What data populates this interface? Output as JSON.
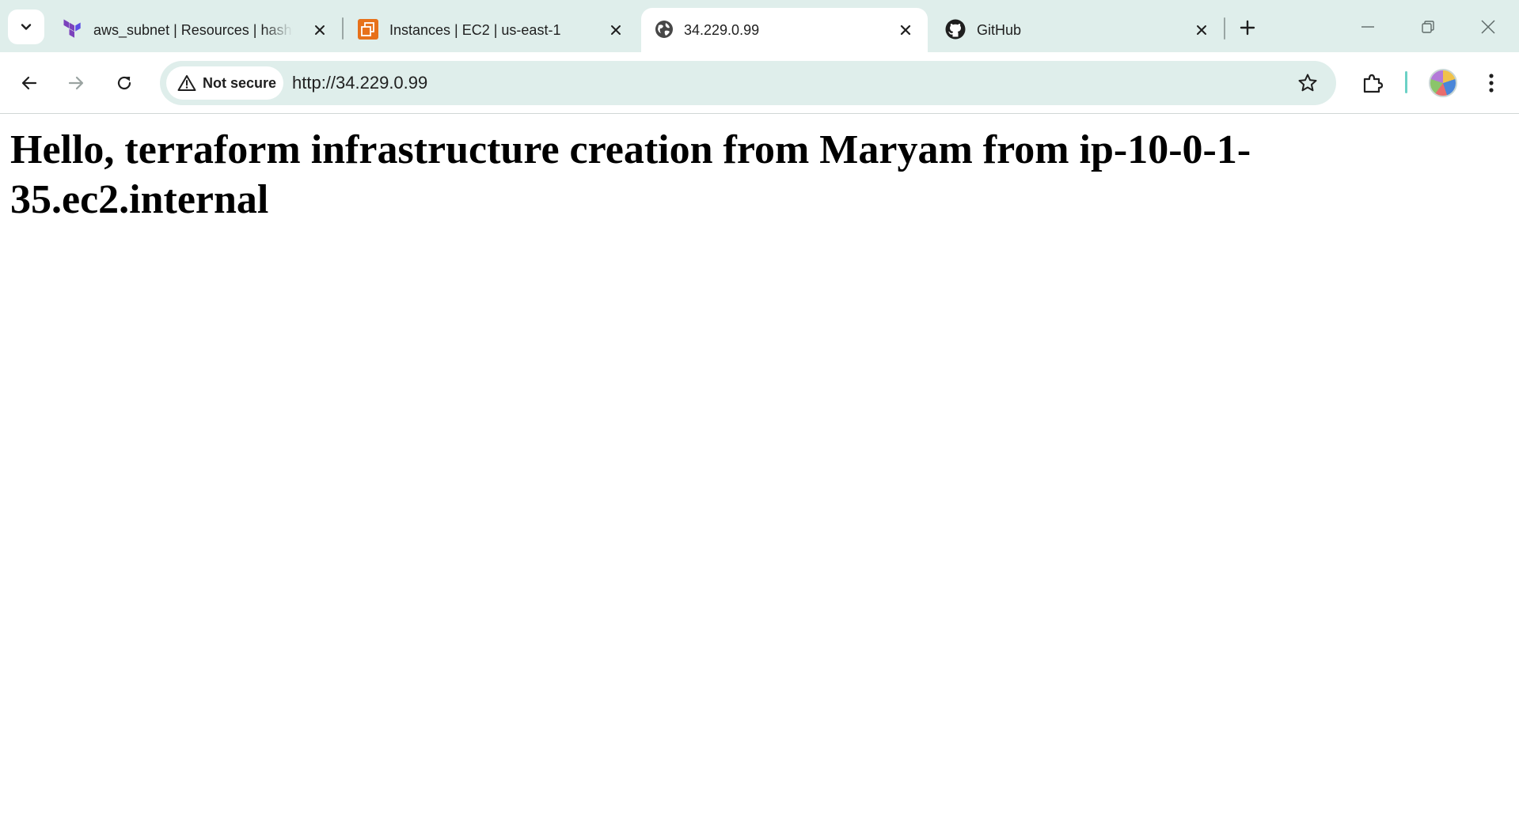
{
  "browser": {
    "tabs": [
      {
        "title": "aws_subnet | Resources | hashic",
        "favicon": "terraform-logo-icon",
        "active": false
      },
      {
        "title": "Instances | EC2 | us-east-1",
        "favicon": "aws-ec2-icon",
        "active": false
      },
      {
        "title": "34.229.0.99",
        "favicon": "globe-icon",
        "active": true
      },
      {
        "title": "GitHub",
        "favicon": "github-icon",
        "active": false
      }
    ],
    "security_chip": {
      "label": "Not secure",
      "icon": "warning-triangle-icon"
    },
    "url": "http://34.229.0.99",
    "colors": {
      "frame": "#dfeeeb",
      "accent": "#6bd1c6",
      "terraform": "#7b42bc",
      "aws": "#e7711b"
    }
  },
  "page": {
    "heading": "Hello, terraform infrastructure creation from Maryam from ip-10-0-1-35.ec2.internal"
  }
}
